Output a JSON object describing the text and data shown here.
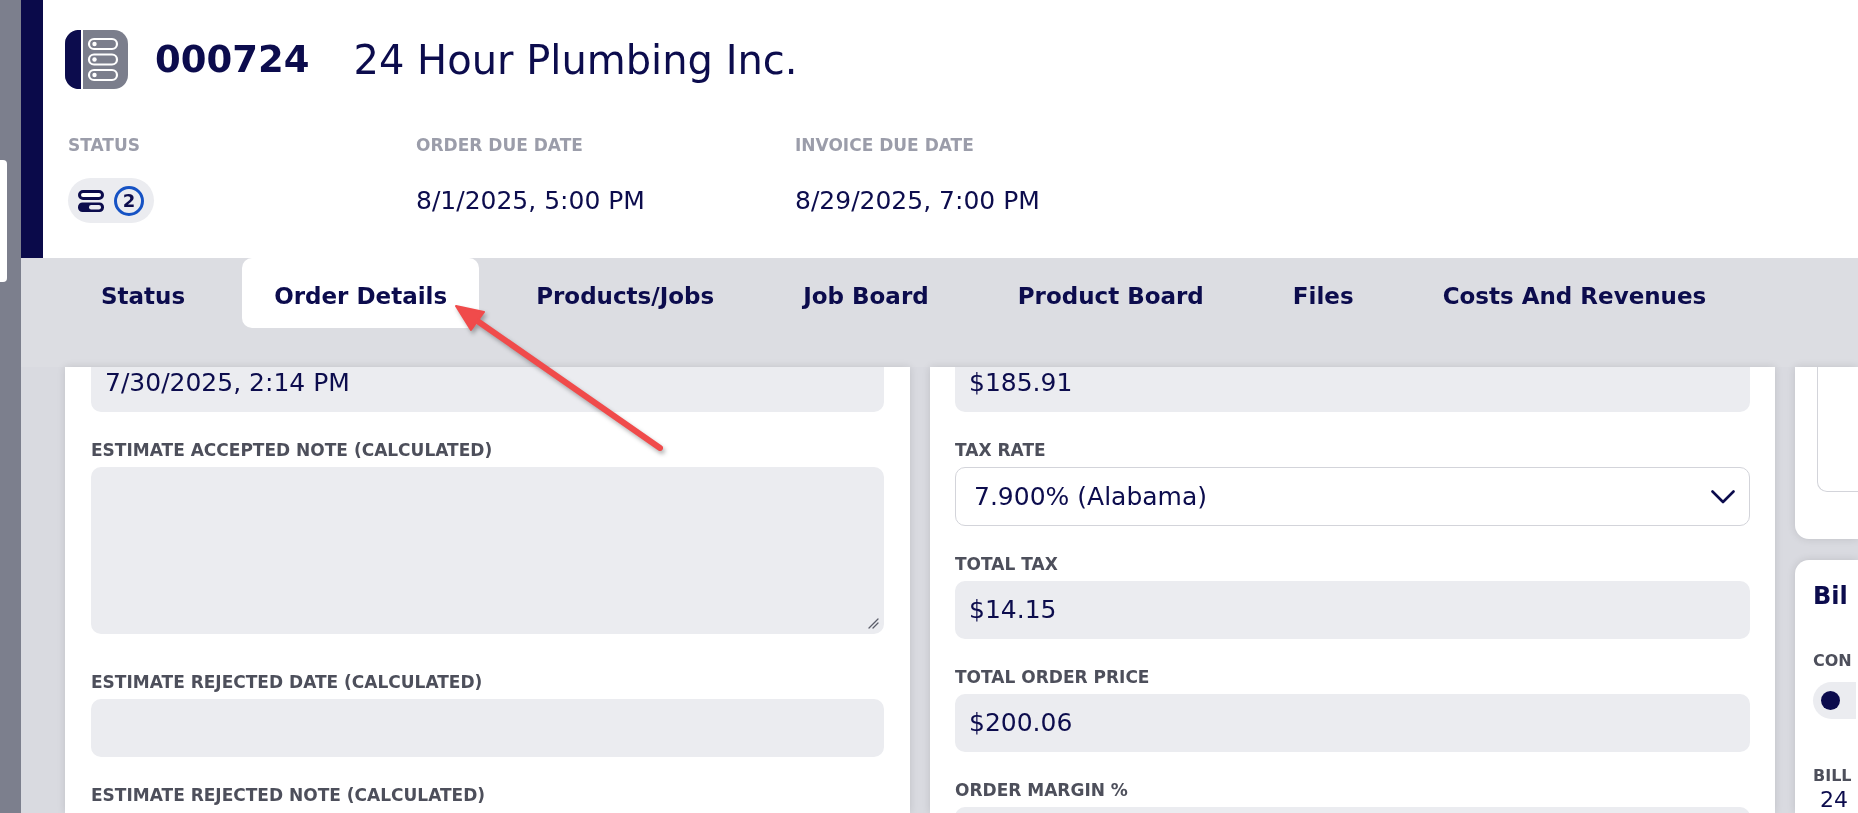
{
  "header": {
    "order_number": "000724",
    "customer": "24 Hour Plumbing Inc.",
    "fields": [
      {
        "kind": "status",
        "label": "STATUS",
        "count": "2"
      },
      {
        "kind": "date",
        "label": "ORDER DUE DATE",
        "value": "8/1/2025, 5:00 PM"
      },
      {
        "kind": "date",
        "label": "INVOICE DUE DATE",
        "value": "8/29/2025, 7:00 PM"
      }
    ]
  },
  "tabs": [
    {
      "label": "Status",
      "selected": false
    },
    {
      "label": "Order Details",
      "selected": true
    },
    {
      "label": "Products/Jobs",
      "selected": false
    },
    {
      "label": "Job Board",
      "selected": false
    },
    {
      "label": "Product Board",
      "selected": false
    },
    {
      "label": "Files",
      "selected": false
    },
    {
      "label": "Costs And Revenues",
      "selected": false
    }
  ],
  "left_panel": {
    "fields": [
      {
        "kind": "readonly",
        "value": "7/30/2025, 2:14 PM"
      },
      {
        "kind": "textarea",
        "label": "ESTIMATE ACCEPTED NOTE (CALCULATED)"
      },
      {
        "kind": "readonly",
        "label": "ESTIMATE REJECTED DATE (CALCULATED)"
      },
      {
        "kind": "label",
        "label": "ESTIMATE REJECTED NOTE (CALCULATED)"
      }
    ]
  },
  "middle_panel": {
    "fields": [
      {
        "kind": "readonly",
        "value": "$185.91"
      },
      {
        "kind": "select",
        "label": "TAX RATE",
        "value": "7.900% (Alabama)"
      },
      {
        "kind": "readonly",
        "label": "TOTAL TAX",
        "value": "$14.15"
      },
      {
        "kind": "readonly",
        "label": "TOTAL ORDER PRICE",
        "value": "$200.06"
      },
      {
        "kind": "readonly",
        "label": "ORDER MARGIN %"
      }
    ]
  },
  "right_panel": {
    "title": "Bil",
    "fields": [
      {
        "kind": "switch",
        "label": "CON",
        "on": false
      },
      {
        "kind": "text",
        "label": "BILL",
        "value": "24"
      }
    ]
  }
}
